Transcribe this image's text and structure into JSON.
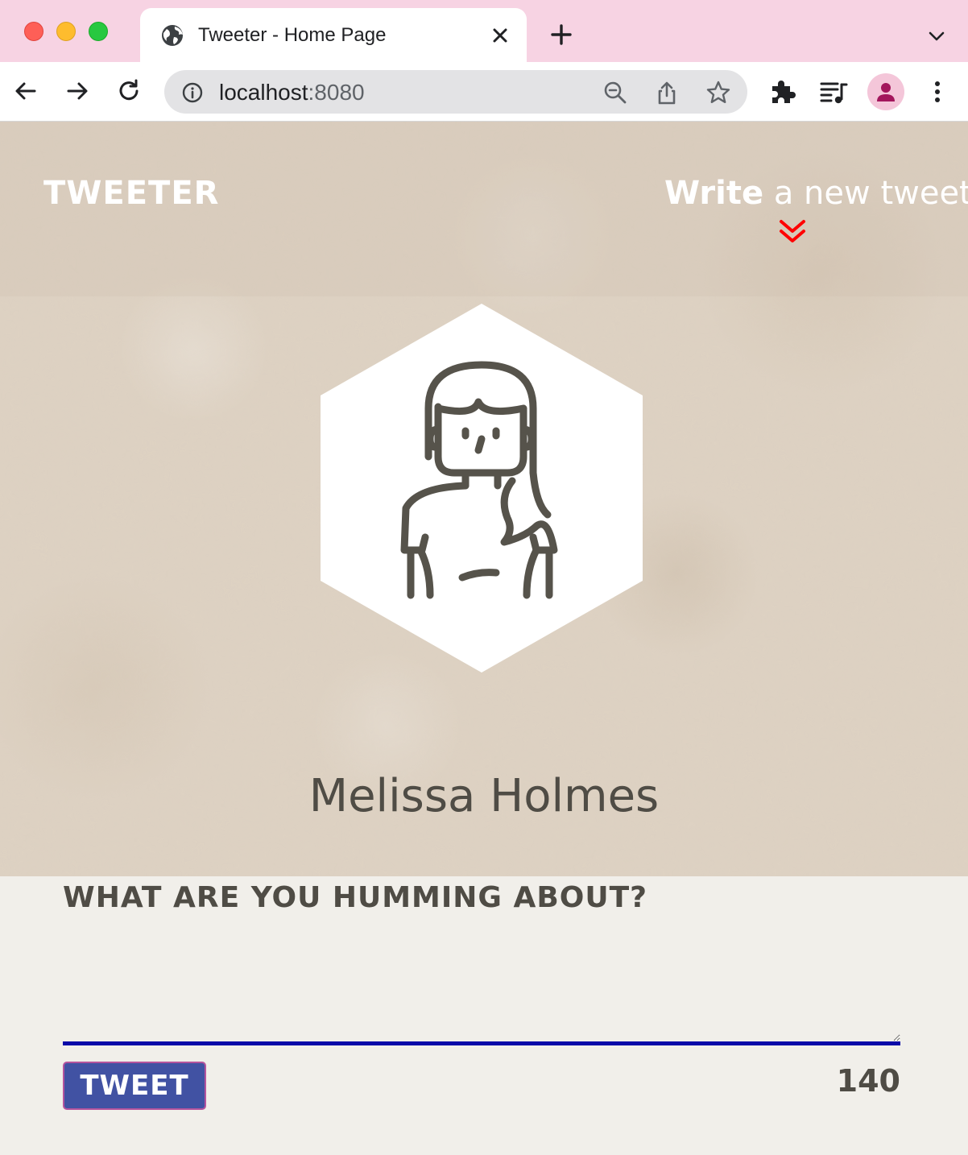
{
  "browser": {
    "tab": {
      "title": "Tweeter - Home Page",
      "favicon": "globe-icon"
    },
    "address": {
      "host": "localhost",
      "port": ":8080"
    },
    "icons": [
      "back-icon",
      "forward-icon",
      "reload-icon",
      "info-icon",
      "zoom-icon",
      "share-icon",
      "bookmark-star-icon",
      "extensions-icon",
      "media-queue-icon",
      "profile-icon",
      "kebab-menu-icon"
    ]
  },
  "nav": {
    "logo": "Tweeter",
    "compose_strong": "Write",
    "compose_rest": " a new tweet",
    "compose_arrow_color": "#ff0000"
  },
  "profile": {
    "name": "Melissa Holmes",
    "avatar": "woman-avatar-icon"
  },
  "composer": {
    "prompt": "What are you humming about?",
    "textarea_value": "",
    "button_label": "Tweet",
    "counter": "140"
  },
  "colors": {
    "tabbar_bg": "#f7d3e3",
    "button_bg": "#4152a3",
    "textarea_underline": "#0a0aa8",
    "text_dark": "#4f4c45"
  }
}
